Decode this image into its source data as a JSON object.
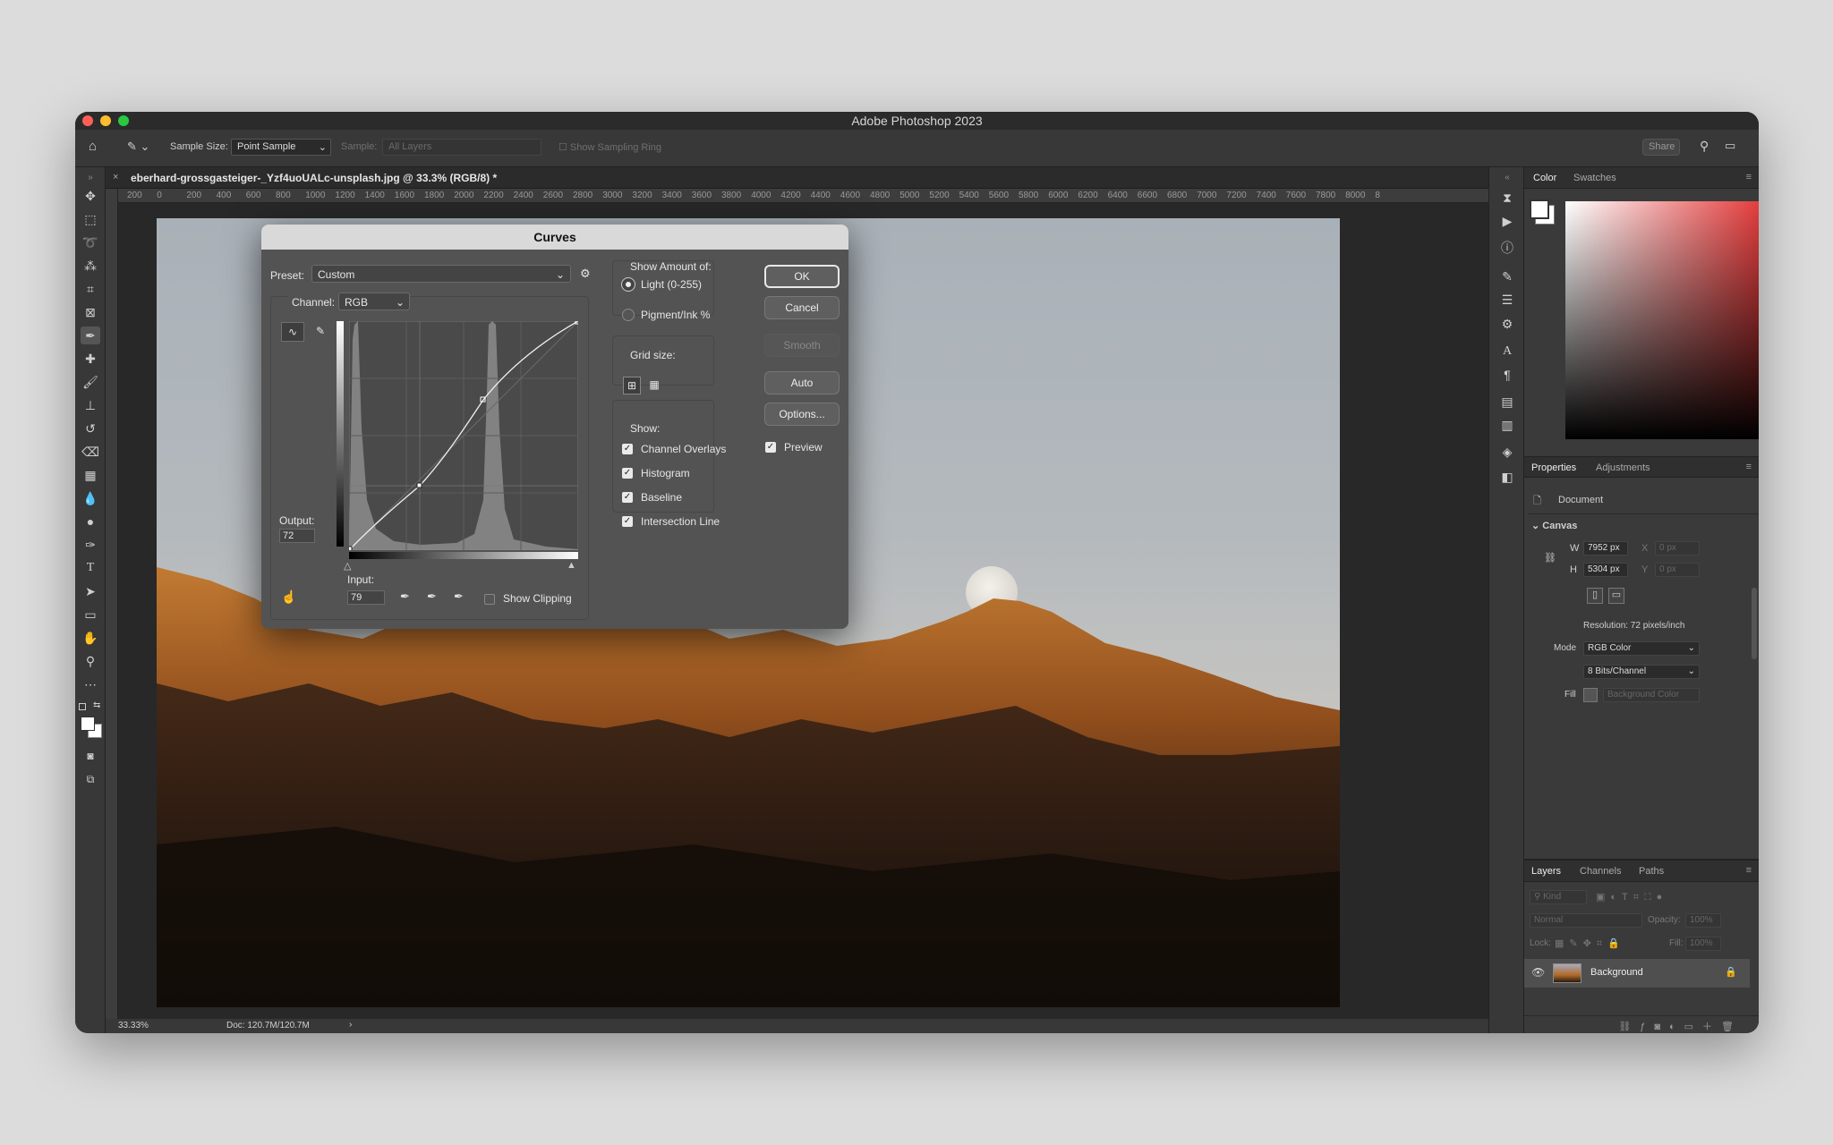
{
  "app": {
    "title": "Adobe Photoshop 2023"
  },
  "options": {
    "sample_size_label": "Sample Size:",
    "sample_size_value": "Point Sample",
    "sample_label": "Sample:",
    "sample_value": "All Layers",
    "show_ring": "Show Sampling Ring",
    "share": "Share"
  },
  "document": {
    "tab_title": "eberhard-grossgasteiger-_Yzf4uoUALc-unsplash.jpg @ 33.3% (RGB/8) *"
  },
  "ruler": {
    "ticks": [
      "200",
      "0",
      "200",
      "400",
      "600",
      "800",
      "1000",
      "1200",
      "1400",
      "1600",
      "1800",
      "2000",
      "2200",
      "2400",
      "2600",
      "2800",
      "3000",
      "3200",
      "3400",
      "3600",
      "3800",
      "4000",
      "4200",
      "4400",
      "4600",
      "4800",
      "5000",
      "5200",
      "5400",
      "5600",
      "5800",
      "6000",
      "6200",
      "6400",
      "6600",
      "6800",
      "7000",
      "7200",
      "7400",
      "7600",
      "7800",
      "8000",
      "8"
    ]
  },
  "status": {
    "zoom": "33.33%",
    "doc": "Doc: 120.7M/120.7M",
    "arrow": "›"
  },
  "curves": {
    "title": "Curves",
    "preset_label": "Preset:",
    "preset_value": "Custom",
    "channel_label": "Channel:",
    "channel_value": "RGB",
    "output_label": "Output:",
    "output_value": "72",
    "input_label": "Input:",
    "input_value": "79",
    "show_clipping": "Show Clipping",
    "show_amount_label": "Show Amount of:",
    "light_label": "Light  (0-255)",
    "pigment_label": "Pigment/Ink %",
    "grid_size_label": "Grid size:",
    "show_label": "Show:",
    "channel_overlays": "Channel Overlays",
    "histogram": "Histogram",
    "baseline": "Baseline",
    "intersection_line": "Intersection Line",
    "ok": "OK",
    "cancel": "Cancel",
    "smooth": "Smooth",
    "auto": "Auto",
    "options": "Options...",
    "preview": "Preview"
  },
  "color_panel": {
    "tab_color": "Color",
    "tab_swatches": "Swatches"
  },
  "properties": {
    "tab_properties": "Properties",
    "tab_adjustments": "Adjustments",
    "document_label": "Document",
    "canvas_label": "Canvas",
    "w_label": "W",
    "w_value": "7952 px",
    "h_label": "H",
    "h_value": "5304 px",
    "x_label": "X",
    "x_value": "0 px",
    "y_label": "Y",
    "y_value": "0 px",
    "resolution": "Resolution: 72 pixels/inch",
    "mode_label": "Mode",
    "mode_value": "RGB Color",
    "bits_value": "8 Bits/Channel",
    "fill_label": "Fill",
    "fill_value": "Background Color"
  },
  "layers": {
    "tab_layers": "Layers",
    "tab_channels": "Channels",
    "tab_paths": "Paths",
    "kind": "Kind",
    "blend": "Normal",
    "opacity_label": "Opacity:",
    "opacity_value": "100%",
    "lock_label": "Lock:",
    "fill_label": "Fill:",
    "fill_value": "100%",
    "layer_name": "Background"
  }
}
